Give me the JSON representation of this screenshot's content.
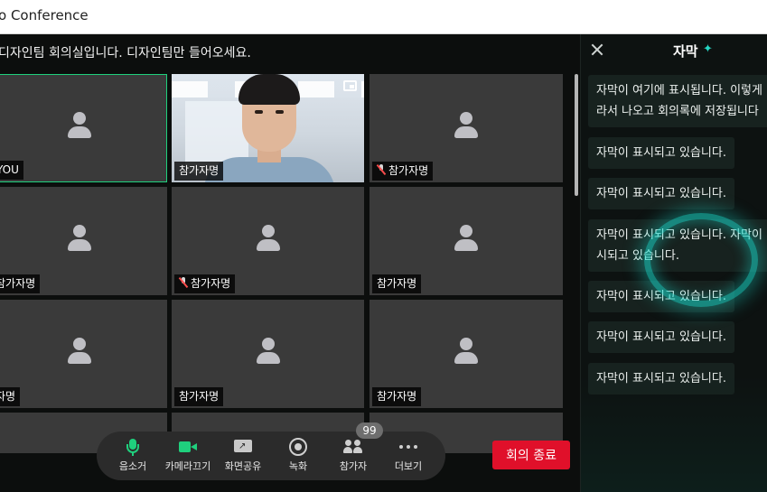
{
  "window": {
    "title": "o Conference"
  },
  "meeting": {
    "room_title": "디자인팀 회의실입니다. 디자인팀만 들어오세요."
  },
  "participants": [
    {
      "name": "YOU",
      "muted": false,
      "video": false,
      "active": true
    },
    {
      "name": "참가자명",
      "muted": false,
      "video": true,
      "active": false
    },
    {
      "name": "참가자명",
      "muted": true,
      "video": false,
      "active": false
    },
    {
      "name": "참가자명",
      "muted": false,
      "video": false,
      "active": false
    },
    {
      "name": "참가자명",
      "muted": true,
      "video": false,
      "active": false
    },
    {
      "name": "참가자명",
      "muted": false,
      "video": false,
      "active": false
    },
    {
      "name": "자명",
      "muted": false,
      "video": false,
      "active": false
    },
    {
      "name": "참가자명",
      "muted": false,
      "video": false,
      "active": false
    },
    {
      "name": "참가자명",
      "muted": false,
      "video": false,
      "active": false
    }
  ],
  "controls": {
    "mute_label": "음소거",
    "camera_label": "카메라끄기",
    "share_label": "화면공유",
    "record_label": "녹화",
    "participants_label": "참가자",
    "participants_count": "99",
    "more_label": "더보기",
    "end_label": "회의 종료"
  },
  "captions": {
    "title": "자막",
    "items": [
      {
        "lines": [
          "자막이 여기에 표시됩니다. 이렇게",
          "라서 나오고 회의록에 저장됩니다"
        ]
      },
      {
        "lines": [
          "자막이 표시되고 있습니다."
        ]
      },
      {
        "lines": [
          "자막이 표시되고 있습니다."
        ]
      },
      {
        "lines": [
          "자막이 표시되고 있습니다. 자막이",
          "시되고 있습니다."
        ]
      },
      {
        "lines": [
          "자막이 표시되고 있습니다."
        ]
      },
      {
        "lines": [
          "자막이 표시되고 있습니다."
        ]
      },
      {
        "lines": [
          "자막이 표시되고 있습니다."
        ]
      }
    ]
  },
  "colors": {
    "accent_green": "#1fd07d",
    "end_button": "#e0102a",
    "caption_glow": "#19dccd",
    "mute_red": "#ff4d4d"
  },
  "icons": [
    "close-icon",
    "sparkle-icon",
    "microphone-icon",
    "camera-icon",
    "screen-share-icon",
    "record-icon",
    "participants-icon",
    "more-icon",
    "pip-icon",
    "muted-mic-icon",
    "person-placeholder-icon"
  ]
}
